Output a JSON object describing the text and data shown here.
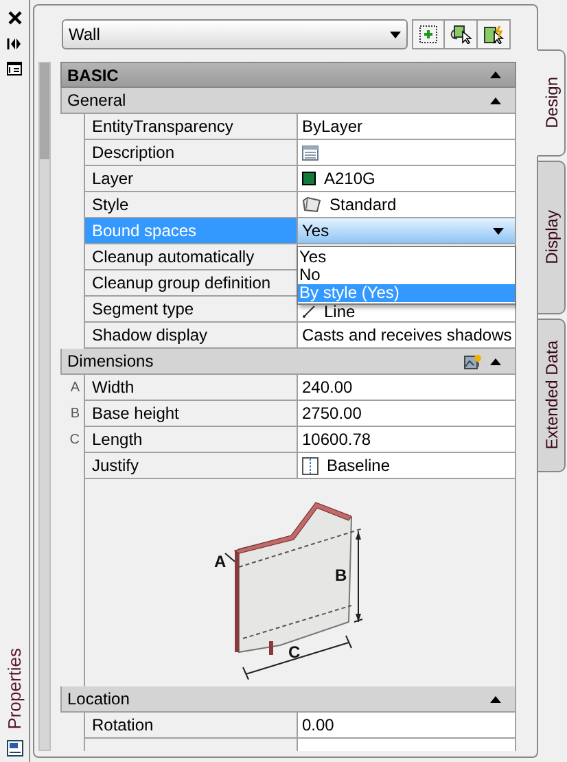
{
  "side_strip": {
    "label": "Properties"
  },
  "object_selector": {
    "value": "Wall"
  },
  "tabs": [
    {
      "label": "Design",
      "selected": true
    },
    {
      "label": "Display",
      "selected": false
    },
    {
      "label": "Extended Data",
      "selected": false
    }
  ],
  "category": {
    "title": "BASIC",
    "expanded": true
  },
  "sections": [
    {
      "title": "General",
      "expanded": true,
      "rows": [
        {
          "label": "EntityTransparency",
          "value": "ByLayer",
          "selected": false
        },
        {
          "label": "Description",
          "kind": "description",
          "selected": false
        },
        {
          "label": "Layer",
          "value": "A210G",
          "kind": "layer",
          "selected": false
        },
        {
          "label": "Style",
          "value": "Standard",
          "kind": "style",
          "selected": false
        },
        {
          "label": "Bound spaces",
          "value": "Yes",
          "selected": true,
          "dropdown": {
            "options": [
              {
                "label": "Yes",
                "selected": false
              },
              {
                "label": "No",
                "selected": false
              },
              {
                "label": "By style (Yes)",
                "selected": true
              }
            ]
          }
        },
        {
          "label": "Cleanup automatically",
          "selected": false
        },
        {
          "label": "Cleanup group definition",
          "selected": false
        },
        {
          "label": "Segment type",
          "value": "Line",
          "kind": "segment",
          "selected": false
        },
        {
          "label": "Shadow display",
          "value": "Casts and receives shadows",
          "selected": false
        }
      ]
    },
    {
      "title": "Dimensions",
      "expanded": true,
      "has_image": true,
      "rows": [
        {
          "marker": "A",
          "label": "Width",
          "value": "240.00",
          "selected": false
        },
        {
          "marker": "B",
          "label": "Base height",
          "value": "2750.00",
          "selected": false
        },
        {
          "marker": "C",
          "label": "Length",
          "value": "10600.78",
          "selected": false
        },
        {
          "label": "Justify",
          "value": "Baseline",
          "kind": "justify",
          "selected": false
        }
      ],
      "diagram_labels": [
        "A",
        "B",
        "C"
      ]
    },
    {
      "title": "Location",
      "expanded": true,
      "rows": [
        {
          "label": "Rotation",
          "value": "0.00",
          "selected": false
        },
        {
          "selected": false
        }
      ]
    }
  ]
}
